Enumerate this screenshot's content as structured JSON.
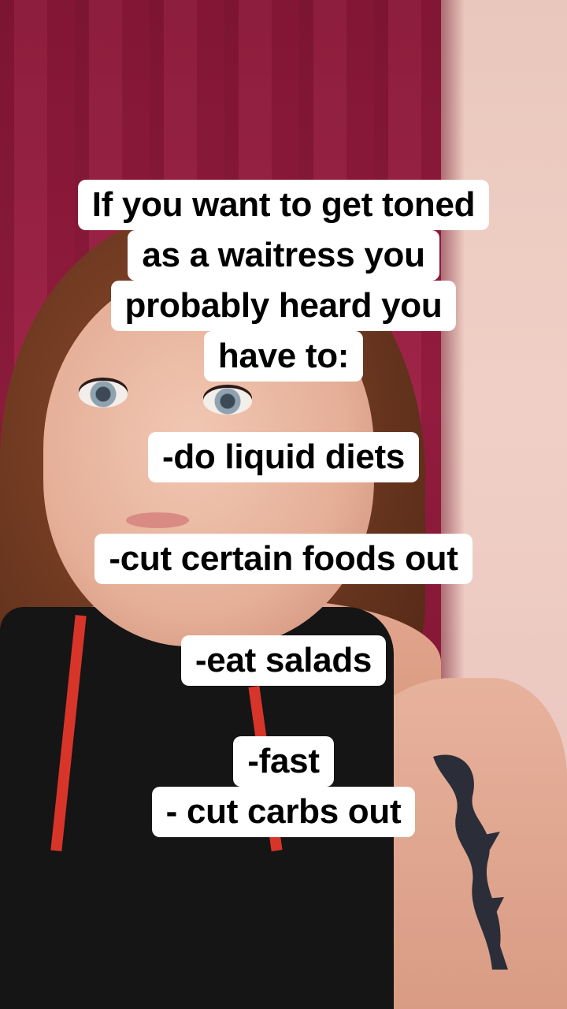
{
  "caption": {
    "intro_lines": [
      "If you want to get toned",
      "as a waitress you",
      "probably heard you",
      "have to:"
    ],
    "items": [
      "-do liquid diets",
      "-cut certain foods out",
      "-eat salads",
      "-fast",
      "- cut carbs out"
    ]
  },
  "colors": {
    "caption_bg": "#ffffff",
    "caption_text": "#000000",
    "curtain": "#9b1d42",
    "wall": "#f0d0c6"
  }
}
